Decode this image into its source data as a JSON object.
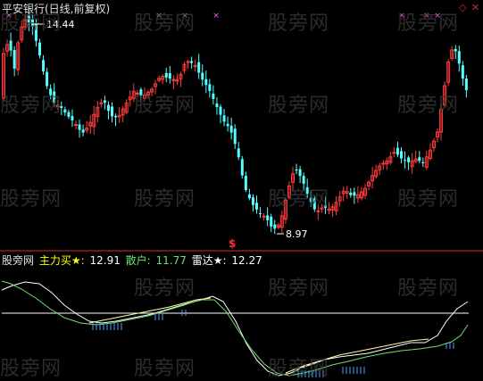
{
  "header": {
    "title": "平安银行(日线,前复权)"
  },
  "annotations": {
    "high_label": "14.44",
    "low_label": "8.97",
    "s_marker": "$"
  },
  "legend": {
    "source": "股旁网",
    "main_label": "主力买★:",
    "main_value": "12.91",
    "retail_label": "散户:",
    "retail_value": "11.77",
    "radar_label": "雷达★:",
    "radar_value": "12.27"
  },
  "watermark": "股旁网",
  "icons": [
    "diamond-icon",
    "close-icon"
  ],
  "colors": {
    "up": "#ff3c3c",
    "down": "#54ffff",
    "main_line": "#ffffff",
    "retail_line": "#70e070",
    "radar_line": "#ffffa0",
    "legend_label": "#ffff00",
    "retail_label": "#70e070",
    "separator": "#c83030",
    "ticks": "#4aa0ff",
    "marker": "#ff60ff"
  }
}
